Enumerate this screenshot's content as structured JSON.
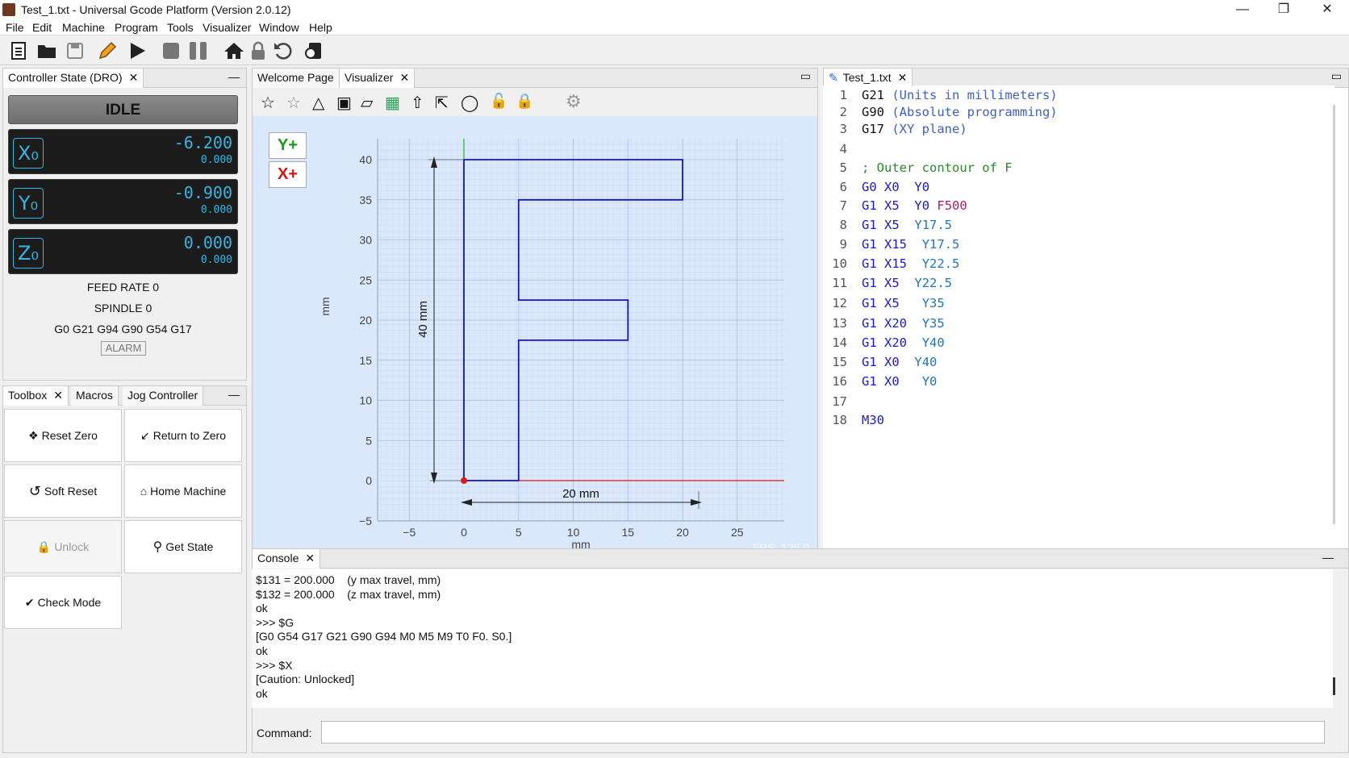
{
  "window": {
    "title": "Test_1.txt - Universal Gcode Platform (Version 2.0.12)"
  },
  "menu": [
    "File",
    "Edit",
    "Machine",
    "Program",
    "Tools",
    "Visualizer",
    "Window",
    "Help"
  ],
  "dro": {
    "tab": "Controller State (DRO)",
    "state": "IDLE",
    "x": {
      "label": "X₀",
      "value": "-6.200",
      "machine": "0.000"
    },
    "y": {
      "label": "Y₀",
      "value": "-0.900",
      "machine": "0.000"
    },
    "z": {
      "label": "Z₀",
      "value": "0.000",
      "machine": "0.000"
    },
    "feed_rate": "FEED RATE 0",
    "spindle": "SPINDLE 0",
    "gcodes": "G0 G21 G94 G90 G54 G17",
    "alarm": "ALARM"
  },
  "toolbox": {
    "tabs": [
      "Toolbox",
      "Macros",
      "Jog Controller"
    ],
    "buttons": {
      "reset_zero": "Reset Zero",
      "return_zero": "Return to Zero",
      "soft_reset": "Soft Reset",
      "home": "Home Machine",
      "unlock": "Unlock",
      "get_state": "Get State",
      "check_mode": "Check Mode"
    }
  },
  "visualizer": {
    "tabs": [
      "Welcome Page",
      "Visualizer"
    ],
    "yplus": "Y+",
    "xplus": "X+",
    "fps": "FPS: 125.0",
    "dim_vertical": "40 mm",
    "dim_horizontal": "20 mm",
    "axis_label_y": "mm",
    "axis_label_x": "mm",
    "y_ticks": [
      "40",
      "35",
      "30",
      "25",
      "20",
      "15",
      "10",
      "5",
      "0",
      "−5"
    ],
    "x_ticks": [
      "−5",
      "0",
      "5",
      "10",
      "15",
      "20",
      "25"
    ]
  },
  "editor": {
    "tab": "Test_1.txt",
    "lines": [
      {
        "n": "1",
        "parts": [
          [
            "kw2",
            "G21"
          ],
          [
            "sp",
            " "
          ],
          [
            "cm",
            "(Units in millimeters)"
          ]
        ]
      },
      {
        "n": "2",
        "parts": [
          [
            "kw2",
            "G90"
          ],
          [
            "sp",
            " "
          ],
          [
            "cm",
            "(Absolute programming)"
          ]
        ]
      },
      {
        "n": "3",
        "parts": [
          [
            "kw2",
            "G17"
          ],
          [
            "sp",
            " "
          ],
          [
            "cm",
            "(XY plane)"
          ]
        ]
      },
      {
        "n": "4",
        "parts": []
      },
      {
        "n": "5",
        "parts": [
          [
            "green",
            "; Outer contour of F"
          ]
        ]
      },
      {
        "n": "6",
        "parts": [
          [
            "kw",
            "G0"
          ],
          [
            "sp",
            " "
          ],
          [
            "kw",
            "X0"
          ],
          [
            "sp",
            "  "
          ],
          [
            "kw",
            "Y0"
          ]
        ]
      },
      {
        "n": "7",
        "parts": [
          [
            "kw",
            "G1"
          ],
          [
            "sp",
            " "
          ],
          [
            "kw",
            "X5"
          ],
          [
            "sp",
            "  "
          ],
          [
            "kw",
            "Y0"
          ],
          [
            "sp",
            " "
          ],
          [
            "fd",
            "F500"
          ]
        ]
      },
      {
        "n": "8",
        "parts": [
          [
            "kw",
            "G1"
          ],
          [
            "sp",
            " "
          ],
          [
            "kw",
            "X5"
          ],
          [
            "sp",
            "  "
          ],
          [
            "gc",
            "Y17.5"
          ]
        ]
      },
      {
        "n": "9",
        "parts": [
          [
            "kw",
            "G1"
          ],
          [
            "sp",
            " "
          ],
          [
            "kw",
            "X15"
          ],
          [
            "sp",
            "  "
          ],
          [
            "gc",
            "Y17.5"
          ]
        ]
      },
      {
        "n": "10",
        "parts": [
          [
            "kw",
            "G1"
          ],
          [
            "sp",
            " "
          ],
          [
            "kw",
            "X15"
          ],
          [
            "sp",
            "  "
          ],
          [
            "gc",
            "Y22.5"
          ]
        ]
      },
      {
        "n": "11",
        "parts": [
          [
            "kw",
            "G1"
          ],
          [
            "sp",
            " "
          ],
          [
            "kw",
            "X5"
          ],
          [
            "sp",
            "  "
          ],
          [
            "gc",
            "Y22.5"
          ]
        ]
      },
      {
        "n": "12",
        "parts": [
          [
            "kw",
            "G1"
          ],
          [
            "sp",
            " "
          ],
          [
            "kw",
            "X5"
          ],
          [
            "sp",
            "   "
          ],
          [
            "gc",
            "Y35"
          ]
        ]
      },
      {
        "n": "13",
        "parts": [
          [
            "kw",
            "G1"
          ],
          [
            "sp",
            " "
          ],
          [
            "kw",
            "X20"
          ],
          [
            "sp",
            "  "
          ],
          [
            "gc",
            "Y35"
          ]
        ]
      },
      {
        "n": "14",
        "parts": [
          [
            "kw",
            "G1"
          ],
          [
            "sp",
            " "
          ],
          [
            "kw",
            "X20"
          ],
          [
            "sp",
            "  "
          ],
          [
            "gc",
            "Y40"
          ]
        ]
      },
      {
        "n": "15",
        "parts": [
          [
            "kw",
            "G1"
          ],
          [
            "sp",
            " "
          ],
          [
            "kw",
            "X0"
          ],
          [
            "sp",
            "  "
          ],
          [
            "gc",
            "Y40"
          ]
        ]
      },
      {
        "n": "16",
        "parts": [
          [
            "kw",
            "G1"
          ],
          [
            "sp",
            " "
          ],
          [
            "kw",
            "X0"
          ],
          [
            "sp",
            "   "
          ],
          [
            "gc",
            "Y0"
          ]
        ]
      },
      {
        "n": "17",
        "parts": []
      },
      {
        "n": "18",
        "parts": [
          [
            "kw",
            "M30"
          ]
        ]
      }
    ]
  },
  "console": {
    "tab": "Console",
    "lines": [
      "$131 = 200.000    (y max travel, mm)",
      "$132 = 200.000    (z max travel, mm)",
      "ok",
      ">>> $G",
      "[G0 G54 G17 G21 G90 G94 M0 M5 M9 T0 F0. S0.]",
      "ok",
      ">>> $X",
      "[Caution: Unlocked]",
      "ok"
    ],
    "command_label": "Command:",
    "command_value": ""
  }
}
